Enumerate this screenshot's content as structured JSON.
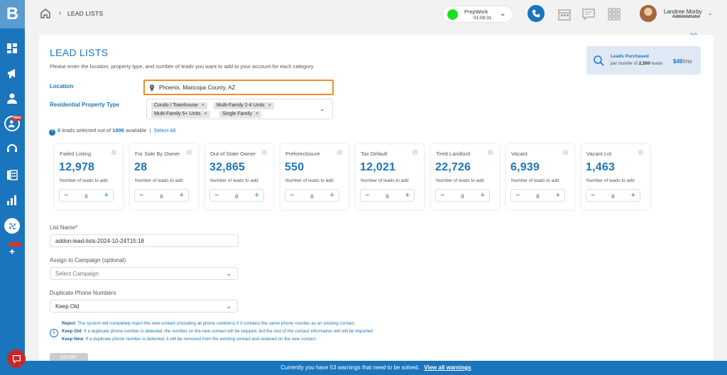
{
  "app": {
    "logo_letter": "B"
  },
  "sidebar": {
    "new_badge": "New",
    "items": [
      "dashboard-icon",
      "megaphone-icon",
      "contacts-icon",
      "user-new-icon",
      "headset-icon",
      "dialer-icon",
      "reports-icon",
      "integrations-icon",
      "ai-sparkle-icon"
    ]
  },
  "header": {
    "breadcrumb": "LEAD LISTS",
    "status": {
      "name": "PrepWork",
      "time": "01:08:31",
      "color": "#1ee11e"
    },
    "user": {
      "name": "Landree Morby",
      "role": "Administrator"
    }
  },
  "page": {
    "title": "LEAD LISTS",
    "subtitle": "Please enter the location, property type, and number of leads you want to add to your account for each category."
  },
  "purchased": {
    "title": "Leads Purchased",
    "sub_prefix": "per bundle of",
    "bundle": "2,500",
    "sub_suffix": "leads",
    "price": "$49",
    "per": "/mo"
  },
  "location": {
    "label": "Location",
    "value": "Phoenix, Maricopa County, AZ"
  },
  "property": {
    "label": "Residential Property Type",
    "chips": [
      "Condo / Townhouse",
      "Multi-Family 2-4 Units",
      "Multi-Family 5+ Units",
      "Single Family"
    ]
  },
  "selection": {
    "selected": "0",
    "text_mid": "leads selected out of",
    "total": "1806",
    "text_end": "available",
    "separator": "|",
    "select_all": "Select All"
  },
  "categories": [
    {
      "name": "Failed Listing",
      "count": "12,978",
      "sub": "Number of leads to add",
      "value": "0"
    },
    {
      "name": "For Sale By Owner",
      "count": "28",
      "sub": "Number of leads to add",
      "value": "0"
    },
    {
      "name": "Out of State Owner",
      "count": "32,865",
      "sub": "Number of leads to add",
      "value": "0"
    },
    {
      "name": "Preforeclosure",
      "count": "550",
      "sub": "Number of leads to add",
      "value": "0"
    },
    {
      "name": "Tax Default",
      "count": "12,021",
      "sub": "Number of leads to add",
      "value": "0"
    },
    {
      "name": "Tired Landlord",
      "count": "22,726",
      "sub": "Number of leads to add",
      "value": "0"
    },
    {
      "name": "Vacant",
      "count": "6,939",
      "sub": "Number of leads to add",
      "value": "0"
    },
    {
      "name": "Vacant Lot",
      "count": "1,463",
      "sub": "Number of leads to add",
      "value": "0"
    }
  ],
  "form": {
    "list_name_label": "List Name*",
    "list_name_value": "addon-lead-lists-2024-10-24T15:18",
    "campaign_label": "Assign to Campaign (optional)",
    "campaign_placeholder": "Select Campaign",
    "duplicate_label": "Duplicate Phone Numbers",
    "duplicate_value": "Keep Old"
  },
  "info": {
    "reject_key": "Reject",
    "reject_text": ": The system will completely reject the new contact (including all phone numbers) if it contains the same phone number as an existing contact.",
    "keep_old_key": "Keep Old",
    "keep_old_text": ": If a duplicate phone number is detected, the number on the new contact will be skipped, but the rest of the contact information will still be imported",
    "keep_new_key": "Keep New",
    "keep_new_text": ": If a duplicate phone number is detected, it will be removed from the existing contact and retained on the new contact."
  },
  "import_button": "IMPORT",
  "warning": {
    "text": "Currently you have 53 warnings that need to be solved.",
    "link": "View all warnings"
  }
}
